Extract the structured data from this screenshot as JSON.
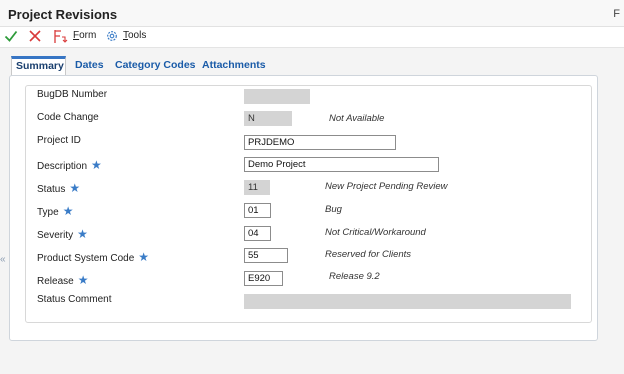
{
  "window": {
    "title": "Project Revisions",
    "right_label": "F"
  },
  "toolbar": {
    "ok_icon": "check-icon",
    "cancel_icon": "close-icon",
    "form_icon": "form-icon",
    "form_label_underlined": "F",
    "form_label_rest": "orm",
    "tools_icon": "gear-icon",
    "tools_label_underlined": "T",
    "tools_label_rest": "ools"
  },
  "tabs": [
    {
      "label": "Summary",
      "active": true
    },
    {
      "label": "Dates",
      "active": false
    },
    {
      "label": "Category Codes",
      "active": false
    },
    {
      "label": "Attachments",
      "active": false
    }
  ],
  "collapse_glyph": "«",
  "form": {
    "bugdb_number": {
      "label": "BugDB Number",
      "value": ""
    },
    "code_change": {
      "label": "Code Change",
      "value": "N",
      "description": "Not Available"
    },
    "project_id": {
      "label": "Project ID",
      "value": "PRJDEMO"
    },
    "description": {
      "label": "Description",
      "required": "★",
      "value": "Demo Project"
    },
    "status": {
      "label": "Status",
      "required": "★",
      "value": "11",
      "description": "New Project Pending Review"
    },
    "type": {
      "label": "Type",
      "required": "★",
      "value": "01",
      "description": "Bug"
    },
    "severity": {
      "label": "Severity",
      "required": "★",
      "value": "04",
      "description": "Not Critical/Workaround"
    },
    "product_system_code": {
      "label": "Product System Code",
      "required": "★",
      "value": "55",
      "description": "Reserved for Clients"
    },
    "release": {
      "label": "Release",
      "required": "★",
      "value": "E920",
      "description": "Release 9.2"
    },
    "status_comment": {
      "label": "Status Comment",
      "value": ""
    }
  },
  "colors": {
    "accent": "#3775c4",
    "tab_text": "#1a5ba8",
    "ok_green": "#2e9b3a",
    "cancel_red": "#d93a3a",
    "required_star": "#3a7cc7"
  }
}
